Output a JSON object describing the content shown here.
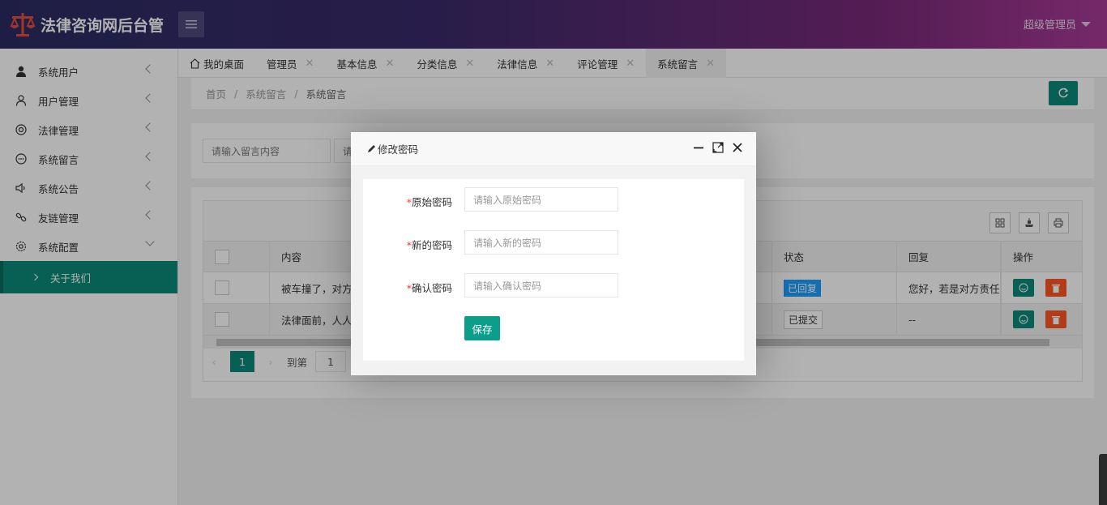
{
  "header": {
    "app_title": "法律咨询网后台管",
    "user_name": "超级管理员"
  },
  "sidebar": {
    "items": [
      {
        "label": "系统用户",
        "icon": "user-filled-icon"
      },
      {
        "label": "用户管理",
        "icon": "user-outline-icon"
      },
      {
        "label": "法律管理",
        "icon": "circle-target-icon"
      },
      {
        "label": "系统留言",
        "icon": "chat-smile-icon"
      },
      {
        "label": "系统公告",
        "icon": "speaker-icon"
      },
      {
        "label": "友链管理",
        "icon": "link-icon"
      },
      {
        "label": "系统配置",
        "icon": "gear-icon"
      }
    ],
    "sub_item": "关于我们"
  },
  "tabs": [
    {
      "label": "我的桌面",
      "closable": false
    },
    {
      "label": "管理员",
      "closable": true
    },
    {
      "label": "基本信息",
      "closable": true
    },
    {
      "label": "分类信息",
      "closable": true
    },
    {
      "label": "法律信息",
      "closable": true
    },
    {
      "label": "评论管理",
      "closable": true
    },
    {
      "label": "系统留言",
      "closable": true,
      "active": true
    }
  ],
  "breadcrumb": [
    "首页",
    "系统留言",
    "系统留言"
  ],
  "search": {
    "placeholder": "请输入留言内容",
    "placeholder2": "请"
  },
  "table": {
    "columns": [
      "内容",
      "状态",
      "回复",
      "操作"
    ],
    "rows": [
      {
        "content": "被车撞了，对方",
        "status": "已回复",
        "reply": "您好，若是对方责任..."
      },
      {
        "content": "法律面前，人人",
        "status": "已提交",
        "reply": "--"
      }
    ]
  },
  "pager": {
    "current": "1",
    "goto_label": "到第",
    "goto_value": "1"
  },
  "dialog": {
    "title": "修改密码",
    "fields": [
      {
        "label": "原始密码",
        "placeholder": "请输入原始密码"
      },
      {
        "label": "新的密码",
        "placeholder": "请输入新的密码"
      },
      {
        "label": "确认密码",
        "placeholder": "请输入确认密码"
      }
    ],
    "required_mark": "*",
    "save_label": "保存"
  },
  "colors": {
    "accent": "#0b8a77",
    "danger": "#ff5722",
    "info": "#1e9fff",
    "header_start": "#2c2b63",
    "header_end": "#a93b96"
  }
}
